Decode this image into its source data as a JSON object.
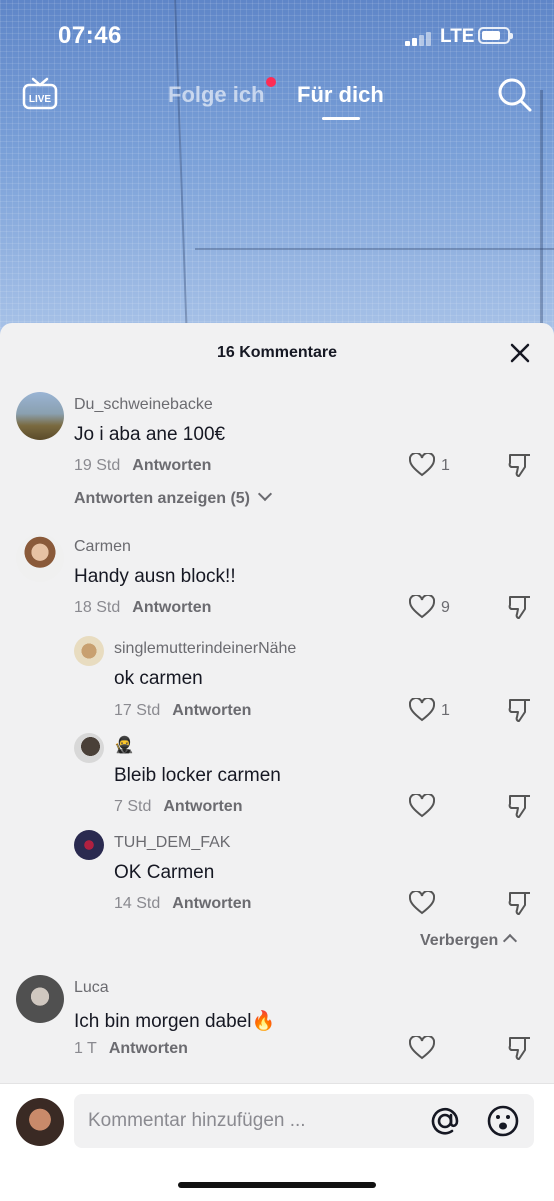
{
  "status_bar": {
    "time": "07:46",
    "network": "LTE"
  },
  "nav": {
    "live_label": "LIVE",
    "tab_following": "Folge ich",
    "tab_foryou": "Für dich"
  },
  "sheet": {
    "title": "16 Kommentare"
  },
  "comments": [
    {
      "username": "Du_schweinebacke",
      "text": "Jo i aba ane 100€",
      "time": "19 Std",
      "reply": "Antworten",
      "likes": "1"
    },
    {
      "username": "Carmen",
      "text": "Handy ausn block!!",
      "time": "18 Std",
      "reply": "Antworten",
      "likes": "9"
    },
    {
      "username": "singlemutterindeinerNähe",
      "text": "ok carmen",
      "time": "17 Std",
      "reply": "Antworten",
      "likes": "1"
    },
    {
      "username": "🥷",
      "text": "Bleib locker carmen",
      "time": "7 Std",
      "reply": "Antworten",
      "likes": ""
    },
    {
      "username": "TUH_DEM_FAK",
      "text": "OK Carmen",
      "time": "14 Std",
      "reply": "Antworten",
      "likes": ""
    },
    {
      "username": "Luca",
      "text": "Ich bin morgen dabel🔥",
      "time": "1 T",
      "reply": "Antworten",
      "likes": ""
    }
  ],
  "view_replies": "Antworten anzeigen (5)",
  "hide_replies": "Verbergen",
  "input": {
    "placeholder": "Kommentar hinzufügen ..."
  },
  "colors": {
    "accent_red": "#fe2c55",
    "sheet_bg": "#f1f1f2",
    "text_primary": "#161823",
    "text_secondary": "#8a8a90"
  }
}
